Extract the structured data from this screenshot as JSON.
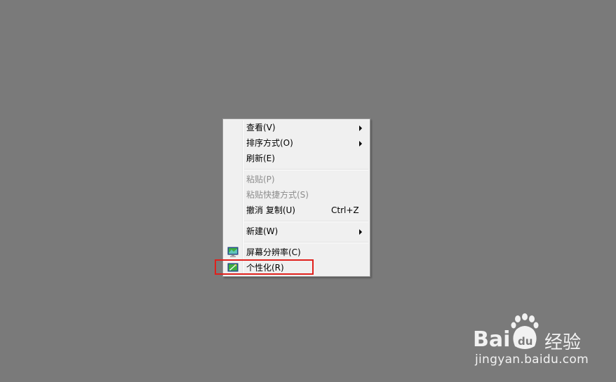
{
  "context_menu": {
    "items": [
      {
        "label": "查看(V)",
        "enabled": true,
        "submenu": true
      },
      {
        "label": "排序方式(O)",
        "enabled": true,
        "submenu": true
      },
      {
        "label": "刷新(E)",
        "enabled": true
      },
      {
        "label": "粘贴(P)",
        "enabled": false
      },
      {
        "label": "粘贴快捷方式(S)",
        "enabled": false
      },
      {
        "label": "撤消 复制(U)",
        "shortcut": "Ctrl+Z",
        "enabled": true
      },
      {
        "label": "新建(W)",
        "enabled": true,
        "submenu": true
      },
      {
        "label": "屏幕分辨率(C)",
        "enabled": true,
        "icon": "display-icon"
      },
      {
        "label": "个性化(R)",
        "enabled": true,
        "icon": "personalize-icon",
        "highlighted": true
      }
    ]
  },
  "annotation": {
    "highlight_color": "#e0201c"
  },
  "watermark": {
    "brand": "Bai du",
    "product": "经验",
    "url": "jingyan.baidu.com"
  },
  "colors": {
    "desktop_background": "#7a7a7a",
    "menu_background": "#f0f0f0",
    "disabled_text": "#8d8d8d"
  }
}
